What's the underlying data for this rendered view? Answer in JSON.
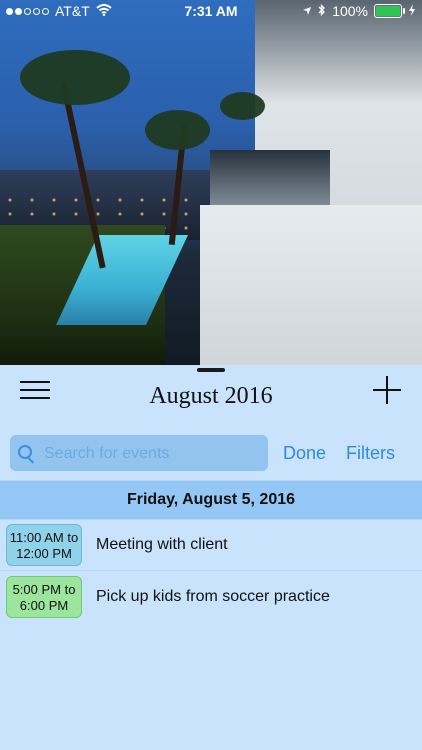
{
  "status_bar": {
    "carrier": "AT&T",
    "time": "7:31 AM",
    "battery": "100%",
    "signal_dots_filled": 2,
    "signal_dots_total": 5,
    "battery_color": "#31c452"
  },
  "calendar_panel": {
    "month_title": "August 2016",
    "icons": [
      "hamburger-menu-icon",
      "plus-icon"
    ],
    "search": {
      "placeholder": "Search for events",
      "value": ""
    },
    "actions": {
      "done": "Done",
      "filters": "Filters"
    },
    "selected_date": "Friday, August 5, 2016",
    "events": [
      {
        "time": "11:00 AM to\n12:00 PM",
        "title": "Meeting with client",
        "color": "#8fd2ea"
      },
      {
        "time": "5:00 PM to\n6:00 PM",
        "title": "Pick up kids from soccer practice",
        "color": "#9be59c"
      }
    ]
  },
  "colors": {
    "panel_background": "#c8e3fb",
    "date_bar_background": "#94c7f5",
    "accent_blue": "#2f8ae0"
  }
}
